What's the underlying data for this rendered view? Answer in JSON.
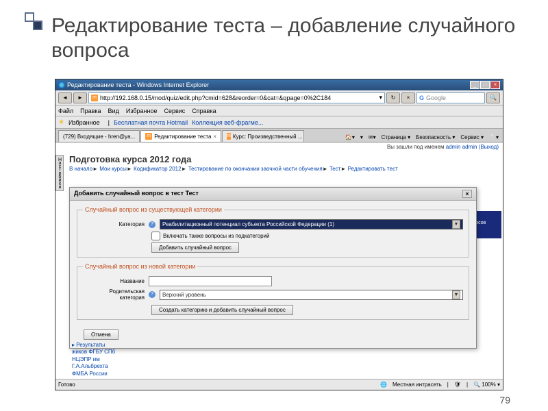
{
  "slide": {
    "title": "Редактирование теста – добавление случайного вопроса",
    "page_number": "79"
  },
  "browser": {
    "window_title": "Редактирование теста - Windows Internet Explorer",
    "url": "http://192.168.0.15/mod/quiz/edit.php?cmid=628&reorder=0&cat=&qpage=0%2C184",
    "search_placeholder": "Google",
    "menu": {
      "file": "Файл",
      "edit": "Правка",
      "view": "Вид",
      "favorites": "Избранное",
      "tools": "Сервис",
      "help": "Справка"
    },
    "favbar": {
      "favorites": "Избранное",
      "hotmail": "Бесплатная почта Hotmail",
      "gallery": "Коллекция веб-фрагме..."
    },
    "tabs": [
      {
        "label": "(729) Входящие - hren@ya..."
      },
      {
        "label": "Редактирование теста",
        "active": true
      },
      {
        "label": "Курс: Произведственный ..."
      }
    ],
    "toolbar_right": {
      "page": "Страница ▾",
      "security": "Безопасность ▾",
      "service": "Сервис ▾"
    },
    "login_text": "Вы зашли под именем ",
    "login_user": "admin admin",
    "login_logout": "(Выход)",
    "course_title": "Подготовка курса 2012 года",
    "breadcrumb": {
      "home": "В начало",
      "sep": "►",
      "my": "Мои курсы",
      "cod": "Кодификатор 2012",
      "testing": "Тестирование по окончании заочной части обучения",
      "test": "Тест",
      "edit": "Редактировать тест"
    },
    "sidebar_label": "Настройки",
    "right_box": "вопросов",
    "bottom": {
      "l1": "▸ Результаты",
      "l2": "жиков ФГБУ СПб",
      "l3": "НЦЭПР им",
      "l4": "Г.А.Альбрехта",
      "l5": "ФМБА России"
    },
    "status": {
      "ready": "Готово",
      "intranet": "Местная интрасеть",
      "zoom": "100%"
    }
  },
  "dialog": {
    "title": "Добавить случайный вопрос в тест Тест",
    "section1_legend": "Случайный вопрос из существующей категории",
    "category_label": "Категория",
    "category_value": "Реабилитационный потенциал субъекта Российской Федерации (1)",
    "subcats_label": "Включать также вопросы из подкатегорий",
    "add_btn": "Добавить случайный вопрос",
    "section2_legend": "Случайный вопрос из новой категории",
    "name_label": "Название",
    "parent_label": "Родительская категория",
    "parent_value": "Верхний уровень",
    "create_btn": "Создать категорию и добавить случайный вопрос",
    "cancel_btn": "Отмена"
  }
}
